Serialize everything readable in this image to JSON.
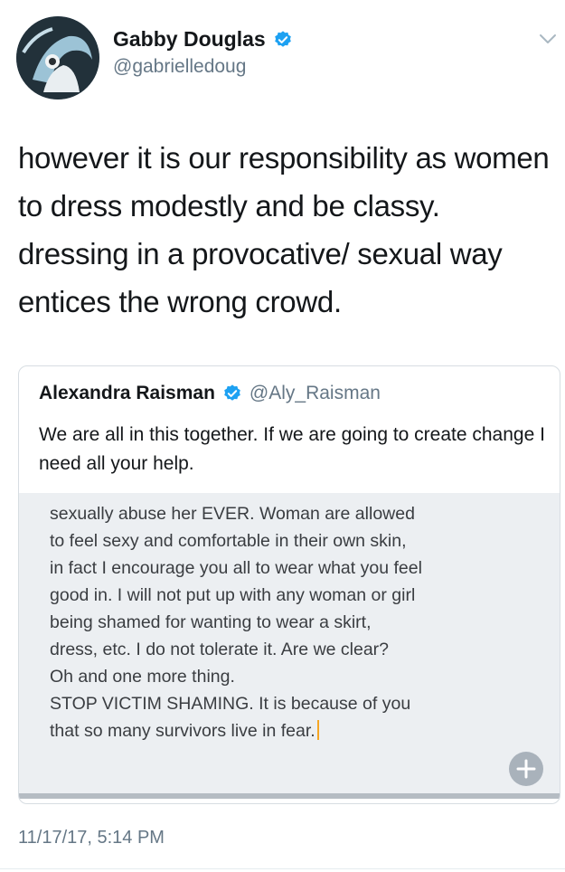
{
  "author": {
    "display_name": "Gabby Douglas",
    "handle": "@gabrielledoug",
    "verified": true,
    "avatar_icon": "profile-avatar"
  },
  "tweet": {
    "text": "however it is our responsibility as women to dress modestly and be classy. dressing in a provocative/ sexual way entices the wrong crowd.",
    "timestamp": "11/17/17, 5:14 PM"
  },
  "quoted_tweet": {
    "display_name": "Alexandra Raisman",
    "handle": "@Aly_Raisman",
    "verified": true,
    "text": "We are all in this together. If we are going to create change I need all your help.",
    "image_text": "sexually abuse her EVER. Woman are allowed\nto feel sexy and comfortable in their own skin,\nin fact I encourage you all to wear what you feel\ngood in. I will not put up with any woman or girl\nbeing shamed for wanting to wear a skirt,\ndress, etc. I do not tolerate it. Are we clear?\nOh and one more thing.\nSTOP VICTIM SHAMING. It is because of you\nthat so many survivors live in fear."
  },
  "colors": {
    "verified_blue": "#1da1f2",
    "secondary_text": "#657786",
    "cursor": "#f5a623",
    "plus_button": "#a9b2bb"
  },
  "icons": {
    "verified": "verified-badge-icon",
    "caret": "chevron-down-icon",
    "plus": "plus-icon"
  }
}
